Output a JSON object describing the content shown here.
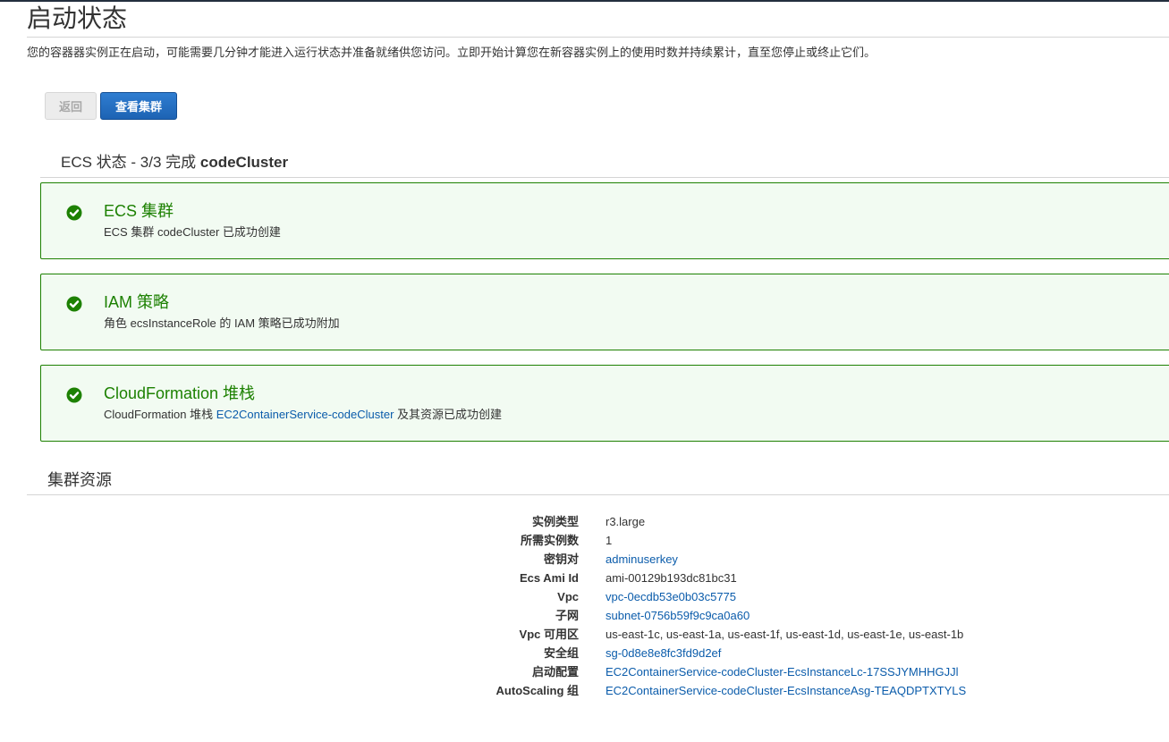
{
  "page": {
    "title": "启动状态",
    "intro": "您的容器器实例正在启动，可能需要几分钟才能进入运行状态并准备就绪供您访问。立即开始计算您在新容器实例上的使用时数并持续累计，直至您停止或终止它们。"
  },
  "buttons": {
    "back": "返回",
    "view_cluster": "查看集群"
  },
  "ecs_status": {
    "heading_prefix": "ECS 状态 - 3/3 完成",
    "cluster_name": "codeCluster",
    "cards": [
      {
        "title": "ECS 集群",
        "desc_before": "ECS 集群 codeCluster 已成功创建",
        "link": "",
        "desc_after": ""
      },
      {
        "title": "IAM 策略",
        "desc_before": "角色 ecsInstanceRole 的 IAM 策略已成功附加",
        "link": "",
        "desc_after": ""
      },
      {
        "title": "CloudFormation 堆栈",
        "desc_before": "CloudFormation 堆栈 ",
        "link": "EC2ContainerService-codeCluster",
        "desc_after": " 及其资源已成功创建"
      }
    ],
    "success_color": "#1d8102"
  },
  "resources": {
    "heading": "集群资源",
    "rows": [
      {
        "label": "实例类型",
        "value": "r3.large",
        "is_link": false
      },
      {
        "label": "所需实例数",
        "value": "1",
        "is_link": false
      },
      {
        "label": "密钥对",
        "value": "adminuserkey",
        "is_link": true
      },
      {
        "label": "Ecs Ami Id",
        "value": "ami-00129b193dc81bc31",
        "is_link": false
      },
      {
        "label": "Vpc",
        "value": "vpc-0ecdb53e0b03c5775",
        "is_link": true
      },
      {
        "label": "子网",
        "value": "subnet-0756b59f9c9ca0a60",
        "is_link": true
      },
      {
        "label": "Vpc 可用区",
        "value": "us-east-1c, us-east-1a, us-east-1f, us-east-1d, us-east-1e, us-east-1b",
        "is_link": false
      },
      {
        "label": "安全组",
        "value": "sg-0d8e8e8fc3fd9d2ef",
        "is_link": true
      },
      {
        "label": "启动配置",
        "value": "EC2ContainerService-codeCluster-EcsInstanceLc-17SSJYMHHGJJl",
        "is_link": true
      },
      {
        "label": "AutoScaling 组",
        "value": "EC2ContainerService-codeCluster-EcsInstanceAsg-TEAQDPTXTYLS",
        "is_link": true
      }
    ]
  },
  "icons": {
    "card_status": "check-circle-icon"
  }
}
